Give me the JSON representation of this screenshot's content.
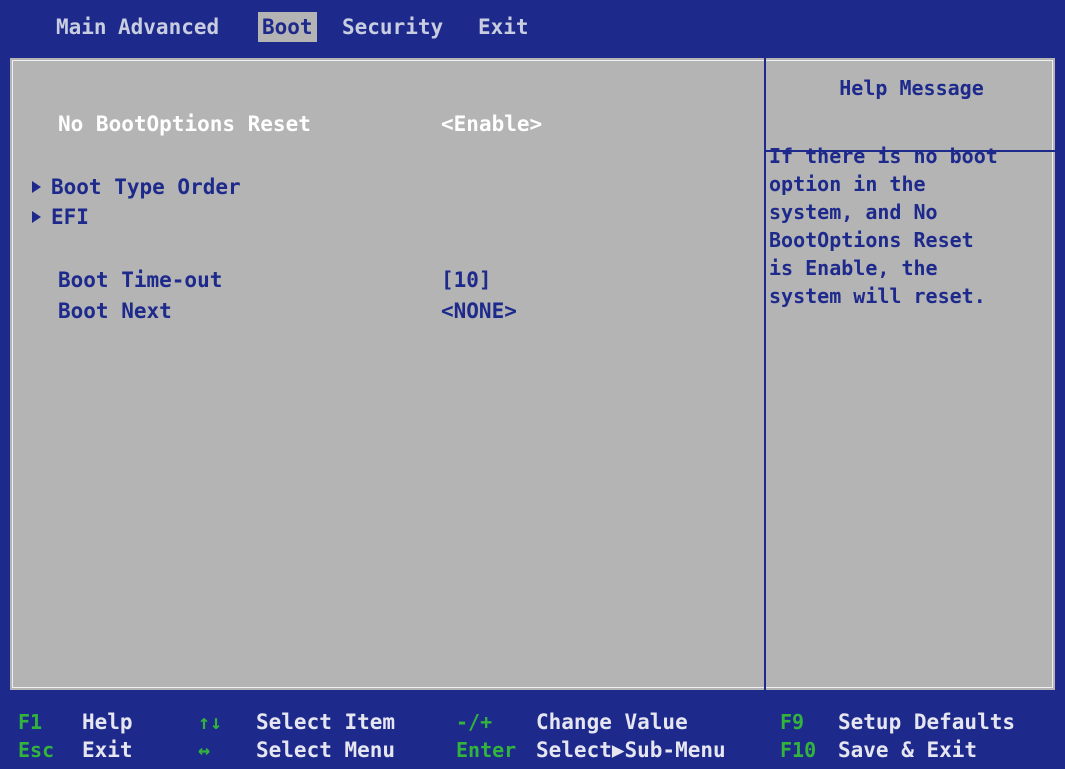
{
  "menu": {
    "tabs": [
      {
        "label": "Main"
      },
      {
        "label": "Advanced"
      },
      {
        "label": "Boot"
      },
      {
        "label": "Security"
      },
      {
        "label": "Exit"
      }
    ],
    "active_tab": "Boot"
  },
  "settings": {
    "no_bootoptions_reset": {
      "label": "No BootOptions Reset",
      "value": "<Enable>"
    },
    "boot_type_order": {
      "label": "Boot Type Order",
      "icon": "submenu-arrow-icon"
    },
    "efi": {
      "label": "EFI",
      "icon": "submenu-arrow-icon"
    },
    "boot_timeout": {
      "label": "Boot Time-out",
      "value": "[10]"
    },
    "boot_next": {
      "label": "Boot Next",
      "value": "<NONE>"
    }
  },
  "help": {
    "title": "Help Message",
    "lines": [
      "If there is no boot",
      "option in the",
      "system, and No",
      "BootOptions Reset",
      "is Enable, the",
      "system will reset."
    ]
  },
  "footer": {
    "keys": [
      {
        "key": "F1",
        "desc": "Help"
      },
      {
        "key": "Esc",
        "desc": "Exit"
      },
      {
        "key": "↑↓",
        "desc": "Select Item"
      },
      {
        "key": "↔",
        "desc": "Select Menu"
      },
      {
        "key": "-/+",
        "desc": "Change Value"
      },
      {
        "key": "Enter",
        "desc": "Select▶Sub-Menu"
      },
      {
        "key": "F9",
        "desc": "Setup Defaults"
      },
      {
        "key": "F10",
        "desc": "Save & Exit"
      }
    ]
  },
  "colors": {
    "background_blue": "#1d2a8c",
    "panel_gray": "#b4b4b4",
    "key_green": "#32b43c",
    "selected_text": "#ffffff"
  }
}
